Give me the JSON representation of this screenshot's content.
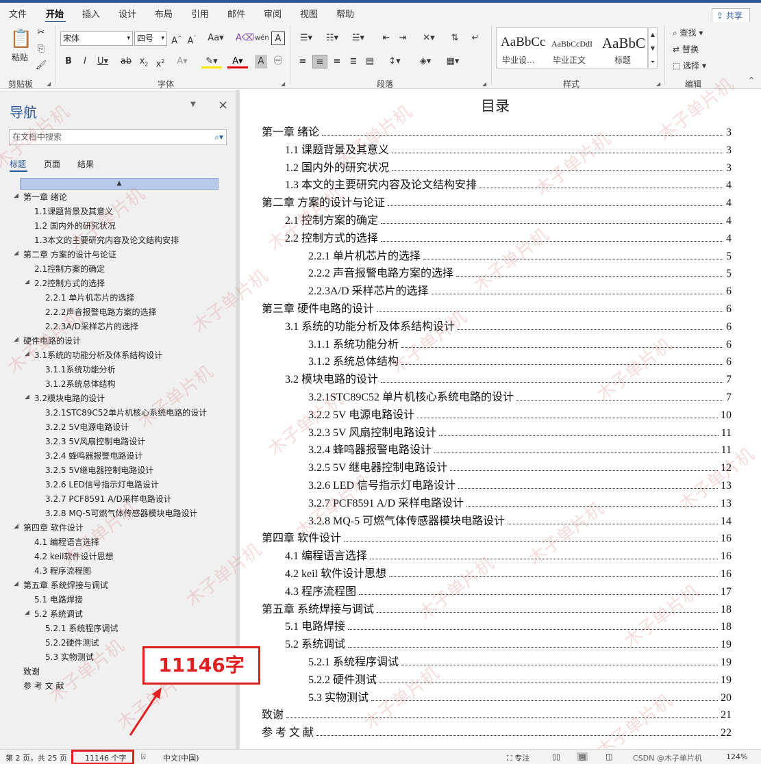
{
  "menu": {
    "items": [
      "文件",
      "开始",
      "插入",
      "设计",
      "布局",
      "引用",
      "邮件",
      "审阅",
      "视图",
      "帮助"
    ],
    "active": "开始",
    "share": "共享"
  },
  "ribbon": {
    "paste": "粘贴",
    "groups": {
      "clipboard": "剪贴板",
      "font": "字体",
      "paragraph": "段落",
      "styles": "样式",
      "edit": "编辑"
    },
    "font_name": "宋体",
    "font_size": "四号",
    "styles": [
      {
        "sample": "AaBbCc",
        "name": "毕业设..."
      },
      {
        "sample": "AaBbCcDdI",
        "name": "毕业正文"
      },
      {
        "sample": "AaBbC",
        "name": "标题"
      }
    ],
    "edit": {
      "find": "查找",
      "replace": "替换",
      "select": "选择"
    }
  },
  "nav": {
    "title": "导航",
    "search_placeholder": "在文档中搜索",
    "tabs": [
      "标题",
      "页面",
      "结果"
    ],
    "items": [
      {
        "label": "第一章 绪论",
        "level": 1,
        "expander": true
      },
      {
        "label": "1.1课题背景及其意义",
        "level": 2
      },
      {
        "label": "1.2 国内外的研究状况",
        "level": 2
      },
      {
        "label": "1.3本文的主要研究内容及论文结构安排",
        "level": 2
      },
      {
        "label": "第二章 方案的设计与论证",
        "level": 1,
        "expander": true
      },
      {
        "label": "2.1控制方案的确定",
        "level": 2
      },
      {
        "label": "2.2控制方式的选择",
        "level": 2,
        "expander": true
      },
      {
        "label": "2.2.1 单片机芯片的选择",
        "level": 3
      },
      {
        "label": "2.2.2声音报警电路方案的选择",
        "level": 3
      },
      {
        "label": "2.2.3A/D采样芯片的选择",
        "level": 3
      },
      {
        "label": "硬件电路的设计",
        "level": 1,
        "expander": true
      },
      {
        "label": "3.1系统的功能分析及体系结构设计",
        "level": 2,
        "expander": true
      },
      {
        "label": "3.1.1系统功能分析",
        "level": 3
      },
      {
        "label": "3.1.2系统总体结构",
        "level": 3
      },
      {
        "label": "3.2模块电路的设计",
        "level": 2,
        "expander": true
      },
      {
        "label": "3.2.1STC89C52单片机核心系统电路的设计",
        "level": 3
      },
      {
        "label": "3.2.2  5V电源电路设计",
        "level": 3
      },
      {
        "label": "3.2.3  5V风扇控制电路设计",
        "level": 3
      },
      {
        "label": "3.2.4  蜂鸣器报警电路设计",
        "level": 3
      },
      {
        "label": "3.2.5  5V继电器控制电路设计",
        "level": 3
      },
      {
        "label": "3.2.6  LED信号指示灯电路设计",
        "level": 3
      },
      {
        "label": "3.2.7  PCF8591  A/D采样电路设计",
        "level": 3
      },
      {
        "label": "3.2.8  MQ-5可燃气体传感器模块电路设计",
        "level": 3
      },
      {
        "label": "第四章 软件设计",
        "level": 1,
        "expander": true
      },
      {
        "label": "4.1 编程语言选择",
        "level": 2
      },
      {
        "label": "4.2 keil软件设计思想",
        "level": 2
      },
      {
        "label": "4.3 程序流程图",
        "level": 2
      },
      {
        "label": "第五章 系统焊接与调试",
        "level": 1,
        "expander": true
      },
      {
        "label": "5.1 电路焊接",
        "level": 2
      },
      {
        "label": "5.2 系统调试",
        "level": 2,
        "expander": true
      },
      {
        "label": "5.2.1 系统程序调试",
        "level": 3
      },
      {
        "label": "5.2.2硬件测试",
        "level": 3
      },
      {
        "label": "5.3 实物测试",
        "level": 3
      },
      {
        "label": "致谢",
        "level": 1
      },
      {
        "label": "参 考 文 献",
        "level": 1
      }
    ]
  },
  "doc": {
    "toc_title": "目录",
    "entries": [
      {
        "text": "第一章  绪论",
        "page": "3",
        "level": 1
      },
      {
        "text": "1.1 课题背景及其意义",
        "page": "3",
        "level": 2
      },
      {
        "text": "1.2 国内外的研究状况",
        "page": "3",
        "level": 2
      },
      {
        "text": "1.3 本文的主要研究内容及论文结构安排",
        "page": "4",
        "level": 2
      },
      {
        "text": "第二章  方案的设计与论证",
        "page": "4",
        "level": 1
      },
      {
        "text": "2.1 控制方案的确定",
        "page": "4",
        "level": 2
      },
      {
        "text": "2.2 控制方式的选择",
        "page": "4",
        "level": 2
      },
      {
        "text": "2.2.1  单片机芯片的选择",
        "page": "5",
        "level": 3
      },
      {
        "text": "2.2.2 声音报警电路方案的选择",
        "page": "5",
        "level": 3
      },
      {
        "text": "2.2.3A/D 采样芯片的选择",
        "page": "6",
        "level": 3
      },
      {
        "text": "第三章  硬件电路的设计",
        "page": "6",
        "level": 1
      },
      {
        "text": "3.1 系统的功能分析及体系结构设计",
        "page": "6",
        "level": 2
      },
      {
        "text": "3.1.1 系统功能分析",
        "page": "6",
        "level": 3
      },
      {
        "text": "3.1.2 系统总体结构",
        "page": "6",
        "level": 3
      },
      {
        "text": "3.2 模块电路的设计",
        "page": "7",
        "level": 2
      },
      {
        "text": "3.2.1STC89C52 单片机核心系统电路的设计",
        "page": "7",
        "level": 3
      },
      {
        "text": "3.2.2 5V 电源电路设计",
        "page": "10",
        "level": 3
      },
      {
        "text": "3.2.3 5V 风扇控制电路设计",
        "page": "11",
        "level": 3
      },
      {
        "text": "3.2.4  蜂鸣器报警电路设计",
        "page": "11",
        "level": 3
      },
      {
        "text": "3.2.5 5V 继电器控制电路设计",
        "page": "12",
        "level": 3
      },
      {
        "text": "3.2.6 LED 信号指示灯电路设计",
        "page": "13",
        "level": 3
      },
      {
        "text": "3.2.7 PCF8591 A/D 采样电路设计",
        "page": "13",
        "level": 3
      },
      {
        "text": "3.2.8 MQ-5 可燃气体传感器模块电路设计",
        "page": "14",
        "level": 3
      },
      {
        "text": "第四章  软件设计",
        "page": "16",
        "level": 1
      },
      {
        "text": "4.1  编程语言选择",
        "page": "16",
        "level": 2
      },
      {
        "text": "4.2 keil 软件设计思想",
        "page": "16",
        "level": 2
      },
      {
        "text": "4.3  程序流程图",
        "page": "17",
        "level": 2
      },
      {
        "text": "第五章  系统焊接与调试",
        "page": "18",
        "level": 1
      },
      {
        "text": "5.1  电路焊接",
        "page": "18",
        "level": 2
      },
      {
        "text": "5.2  系统调试",
        "page": "19",
        "level": 2
      },
      {
        "text": "5.2.1  系统程序调试",
        "page": "19",
        "level": 3
      },
      {
        "text": "5.2.2 硬件测试",
        "page": "19",
        "level": 3
      },
      {
        "text": "5.3  实物测试",
        "page": "20",
        "level": 3
      },
      {
        "text": "致谢",
        "page": "21",
        "level": 1
      },
      {
        "text": "参  考  文  献",
        "page": "22",
        "level": 1
      }
    ]
  },
  "status": {
    "page": "第 2 页，共 25 页",
    "words": "11146 个字",
    "lang": "中文(中国)",
    "focus": "专注",
    "zoom": "124%"
  },
  "annotation": {
    "label": "11146字"
  },
  "watermark": {
    "text": "木子单片机",
    "credit": "CSDN @木子单片机"
  },
  "colors": {
    "accent": "#2b579a",
    "highlight": "#e02020"
  }
}
